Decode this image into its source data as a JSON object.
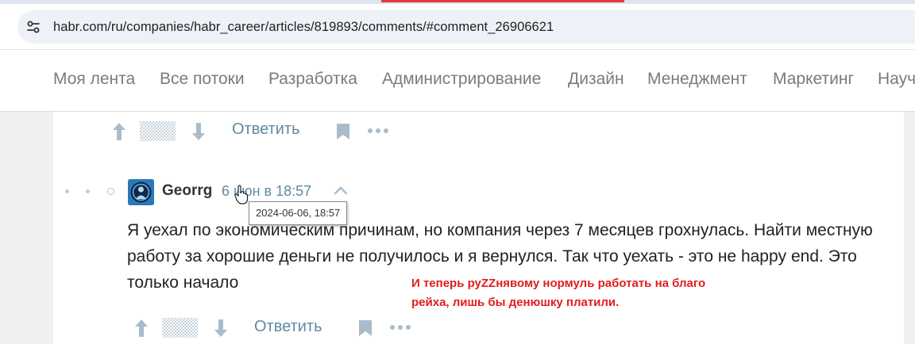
{
  "browser": {
    "url": "habr.com/ru/companies/habr_career/articles/819893/comments/#comment_26906621"
  },
  "nav": {
    "items": [
      "Моя лента",
      "Все потоки",
      "Разработка",
      "Администрирование",
      "Дизайн",
      "Менеджмент",
      "Маркетинг",
      "Научпоп"
    ]
  },
  "prev_comment": {
    "reply_label": "Ответить"
  },
  "comment": {
    "author": "Georrg",
    "date": "6 июн в 18:57",
    "tooltip": "2024-06-06, 18:57",
    "text": "Я уехал по экономическим причинам, но компания через 7 месяцев грохнулась. Найти местную работу за хорошие деньги не получилось и я вернулся. Так что уехать - это не happy end. Это только начало",
    "reply_label": "Ответить"
  },
  "annotation": {
    "text": "И теперь руZZнявому нормуль работать на благо рейха, лишь бы денюшку платили."
  },
  "colors": {
    "link": "#5e8aa3",
    "annotation": "#e21c1c",
    "icon": "#a9bccb"
  }
}
